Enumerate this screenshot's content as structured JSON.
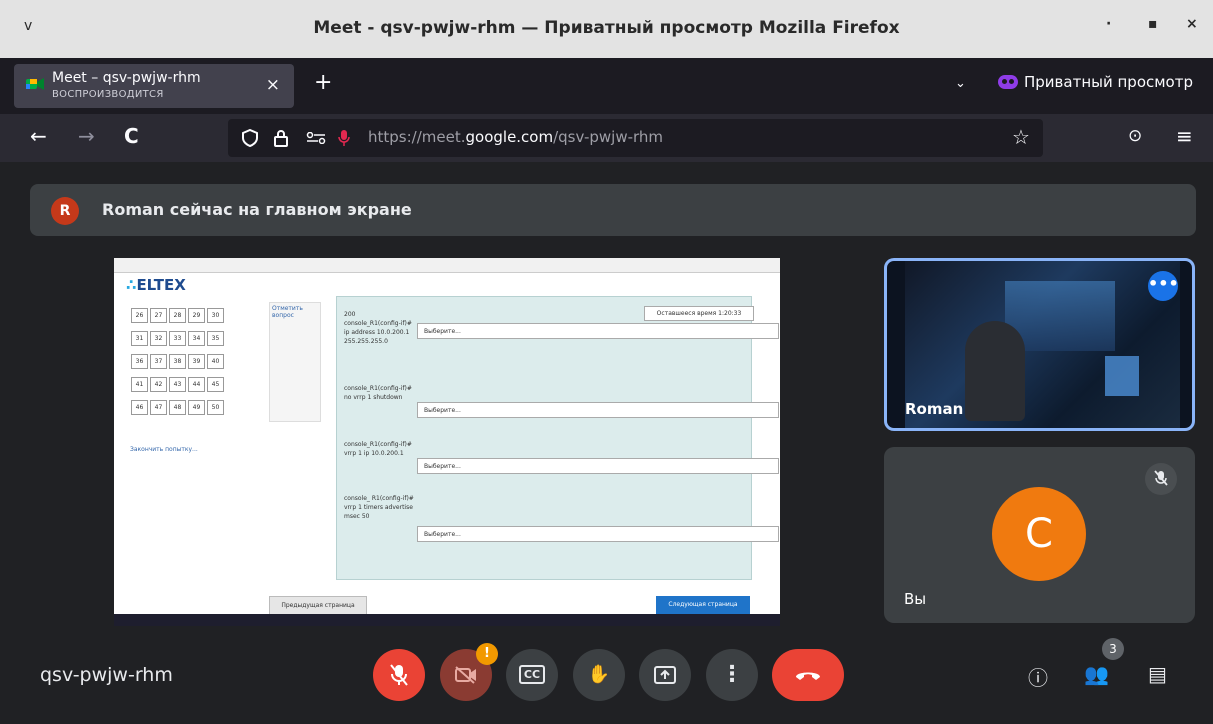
{
  "window": {
    "title": "Meet - qsv-pwjw-rhm — Приватный просмотр Mozilla Firefox",
    "menu_glyph": "ⅴ",
    "minimize": "·",
    "maximize": "▪",
    "close": "×"
  },
  "tab": {
    "title": "Meet – qsv-pwjw-rhm",
    "status": "ВОСПРОИЗВОДИТСЯ",
    "close": "×",
    "new_tab": "+"
  },
  "private_mode": {
    "label": "Приватный просмотр",
    "list_glyph": "⌄"
  },
  "nav": {
    "back": "←",
    "forward": "→",
    "reload": "C",
    "url_prefix": "https://meet.",
    "url_domain": "google.com",
    "url_path": "/qsv-pwjw-rhm",
    "bookmark": "☆",
    "pocket": "⊙",
    "menu": "≡"
  },
  "banner": {
    "avatar_letter": "R",
    "text": "Roman сейчас на главном экране"
  },
  "presentation": {
    "logo": "ELTEX",
    "timer": "Оставшееся время 1:20:33",
    "flag_text": "Отметить вопрос",
    "finish_link": "Закончить попытку...",
    "grid": [
      "26",
      "27",
      "28",
      "29",
      "30",
      "31",
      "32",
      "33",
      "34",
      "35",
      "36",
      "37",
      "38",
      "39",
      "40",
      "41",
      "42",
      "43",
      "44",
      "45",
      "46",
      "47",
      "48",
      "49",
      "50"
    ],
    "questions": [
      {
        "text": "200 console_R1(config-if)# ip address 10.0.200.1 255.255.255.0",
        "select": "Выберите..."
      },
      {
        "text": "console_R1(config-if)# no vrrp 1 shutdown",
        "select": "Выберите..."
      },
      {
        "text": "console_R1(config-if)# vrrp 1 ip 10.0.200.1",
        "select": "Выберите..."
      },
      {
        "text": "console_ R1(config-if)# vrrp 1 timers advertise msec 50",
        "select": "Выберите..."
      }
    ],
    "prev_button": "Предыдущая страница",
    "next_button": "Следующая страница"
  },
  "participants": [
    {
      "name": "Roman",
      "more": "•••"
    },
    {
      "name": "Вы",
      "avatar_letter": "C",
      "mic_muted": "🎙"
    }
  ],
  "controls": {
    "meeting_code": "qsv-pwjw-rhm",
    "mic": "🎙",
    "camera": "◫",
    "camera_warning": "!",
    "captions": "CC",
    "raise_hand": "✋",
    "present": "⬆",
    "more": "⋮",
    "hangup": "☎",
    "info": "ⓘ",
    "people": "👥",
    "people_count": "3",
    "chat": "▤"
  }
}
